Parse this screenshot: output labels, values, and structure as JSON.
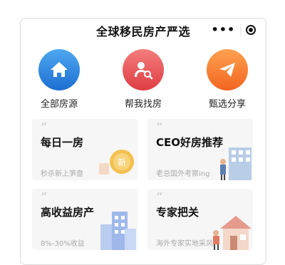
{
  "header": {
    "title": "全球移民房产严选",
    "more_icon": "more-dots-icon",
    "close_icon": "target-icon"
  },
  "features": [
    {
      "label": "全部房源",
      "icon": "house-icon",
      "color": "#2f86e2"
    },
    {
      "label": "帮我找房",
      "icon": "person-search-icon",
      "color": "#e8545a"
    },
    {
      "label": "甄选分享",
      "icon": "paper-plane-icon",
      "color": "#f57b2e"
    }
  ],
  "cards": [
    {
      "title": "每日一房",
      "subtitle": "秒杀新上笋盘",
      "illustration": "coin-icon"
    },
    {
      "title": "CEO好房推荐",
      "subtitle": "老总国外考察ing",
      "illustration": "building-people-icon"
    },
    {
      "title": "高收益房产",
      "subtitle": "8%-30%收益",
      "illustration": "buildings-icon"
    },
    {
      "title": "专家把关",
      "subtitle": "海外专家实地采风",
      "illustration": "house-person-icon"
    }
  ]
}
